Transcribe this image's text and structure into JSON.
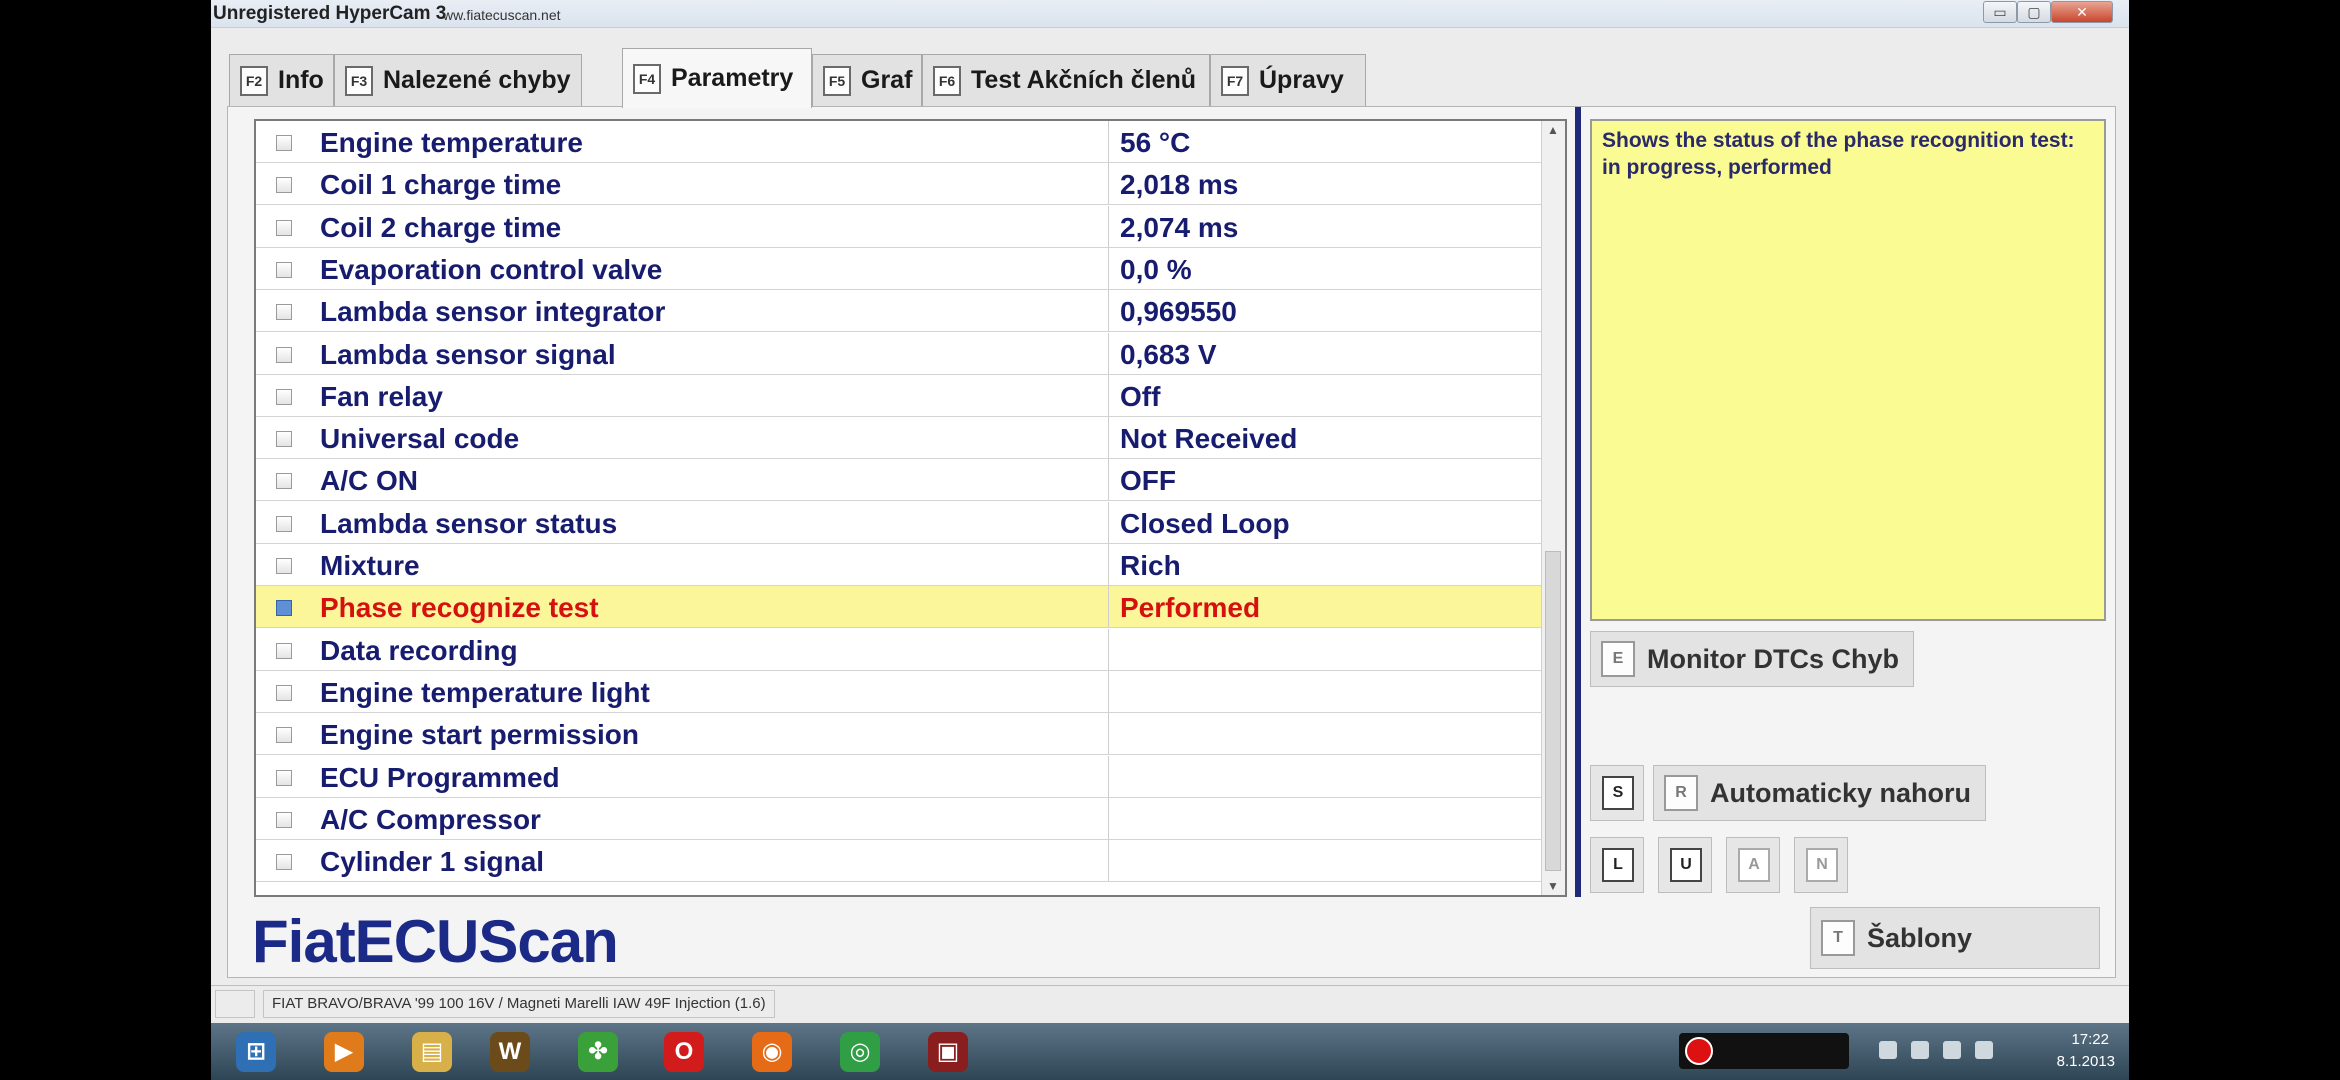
{
  "window": {
    "title": "Unregistered HyperCam 3",
    "watermark_url": "ww.fiatecuscan.net",
    "controls": {
      "minimize": "▭",
      "maximize": "▢",
      "close": "✕"
    }
  },
  "tabs": [
    {
      "key": "F2",
      "label": "Info",
      "active": false
    },
    {
      "key": "F3",
      "label": "Nalezené chyby",
      "active": false
    },
    {
      "key": "F4",
      "label": "Parametry",
      "active": true
    },
    {
      "key": "F5",
      "label": "Graf",
      "active": false
    },
    {
      "key": "F6",
      "label": "Test Akčních členů",
      "active": false
    },
    {
      "key": "F7",
      "label": "Úpravy",
      "active": false
    }
  ],
  "parameters": [
    {
      "name": "Engine temperature",
      "value": "56 °C",
      "checked": false
    },
    {
      "name": "Coil 1 charge time",
      "value": "2,018 ms",
      "checked": false
    },
    {
      "name": "Coil 2 charge time",
      "value": "2,074 ms",
      "checked": false
    },
    {
      "name": "Evaporation control valve",
      "value": "0,0 %",
      "checked": false
    },
    {
      "name": "Lambda sensor integrator",
      "value": "0,969550",
      "checked": false
    },
    {
      "name": "Lambda sensor signal",
      "value": "0,683 V",
      "checked": false
    },
    {
      "name": "Fan relay",
      "value": "Off",
      "checked": false
    },
    {
      "name": "Universal code",
      "value": "Not Received",
      "checked": false
    },
    {
      "name": "A/C ON",
      "value": "OFF",
      "checked": false
    },
    {
      "name": "Lambda sensor status",
      "value": "Closed Loop",
      "checked": false
    },
    {
      "name": "Mixture",
      "value": "Rich",
      "checked": false
    },
    {
      "name": "Phase recognize test",
      "value": "Performed",
      "checked": true,
      "selected": true
    },
    {
      "name": "Data recording",
      "value": "",
      "checked": false
    },
    {
      "name": "Engine temperature light",
      "value": "",
      "checked": false
    },
    {
      "name": "Engine start permission",
      "value": "",
      "checked": false
    },
    {
      "name": "ECU Programmed",
      "value": "",
      "checked": false
    },
    {
      "name": "A/C Compressor",
      "value": "",
      "checked": false
    },
    {
      "name": "Cylinder 1 signal",
      "value": "",
      "checked": false
    }
  ],
  "description": "Shows the status of the phase recognition test: in progress, performed",
  "side": {
    "monitor": {
      "key": "E",
      "label": "Monitor DTCs Chyb"
    },
    "s_key": "S",
    "auto": {
      "key": "R",
      "label": "Automaticky nahoru"
    },
    "small_keys": [
      {
        "key": "L",
        "enabled": true
      },
      {
        "key": "U",
        "enabled": true
      },
      {
        "key": "A",
        "enabled": false
      },
      {
        "key": "N",
        "enabled": false
      }
    ],
    "templates": {
      "key": "T",
      "label": "Šablony"
    }
  },
  "logo": "FiatECUScan",
  "status": "FIAT BRAVO/BRAVA '99 100 16V / Magneti Marelli IAW 49F Injection (1.6)",
  "taskbar": {
    "clock_time": "17:22",
    "clock_date": "8.1.2013",
    "apps": [
      {
        "name": "start-orb-icon",
        "glyph": "⊞",
        "color": "#2f6fb3"
      },
      {
        "name": "media-player-icon",
        "glyph": "▶",
        "color": "#e07b1c"
      },
      {
        "name": "explorer-folder-icon",
        "glyph": "▤",
        "color": "#d8b04a"
      },
      {
        "name": "warcraft-icon",
        "glyph": "W",
        "color": "#6b4b1a"
      },
      {
        "name": "clover-app-icon",
        "glyph": "✤",
        "color": "#3aa03a"
      },
      {
        "name": "opera-icon",
        "glyph": "O",
        "color": "#d21b1b"
      },
      {
        "name": "firefox-icon",
        "glyph": "◉",
        "color": "#e66b16"
      },
      {
        "name": "chrome-icon",
        "glyph": "◎",
        "color": "#2f9e44"
      },
      {
        "name": "ecuscan-app-icon",
        "glyph": "▣",
        "color": "#8a1d1d"
      }
    ]
  }
}
